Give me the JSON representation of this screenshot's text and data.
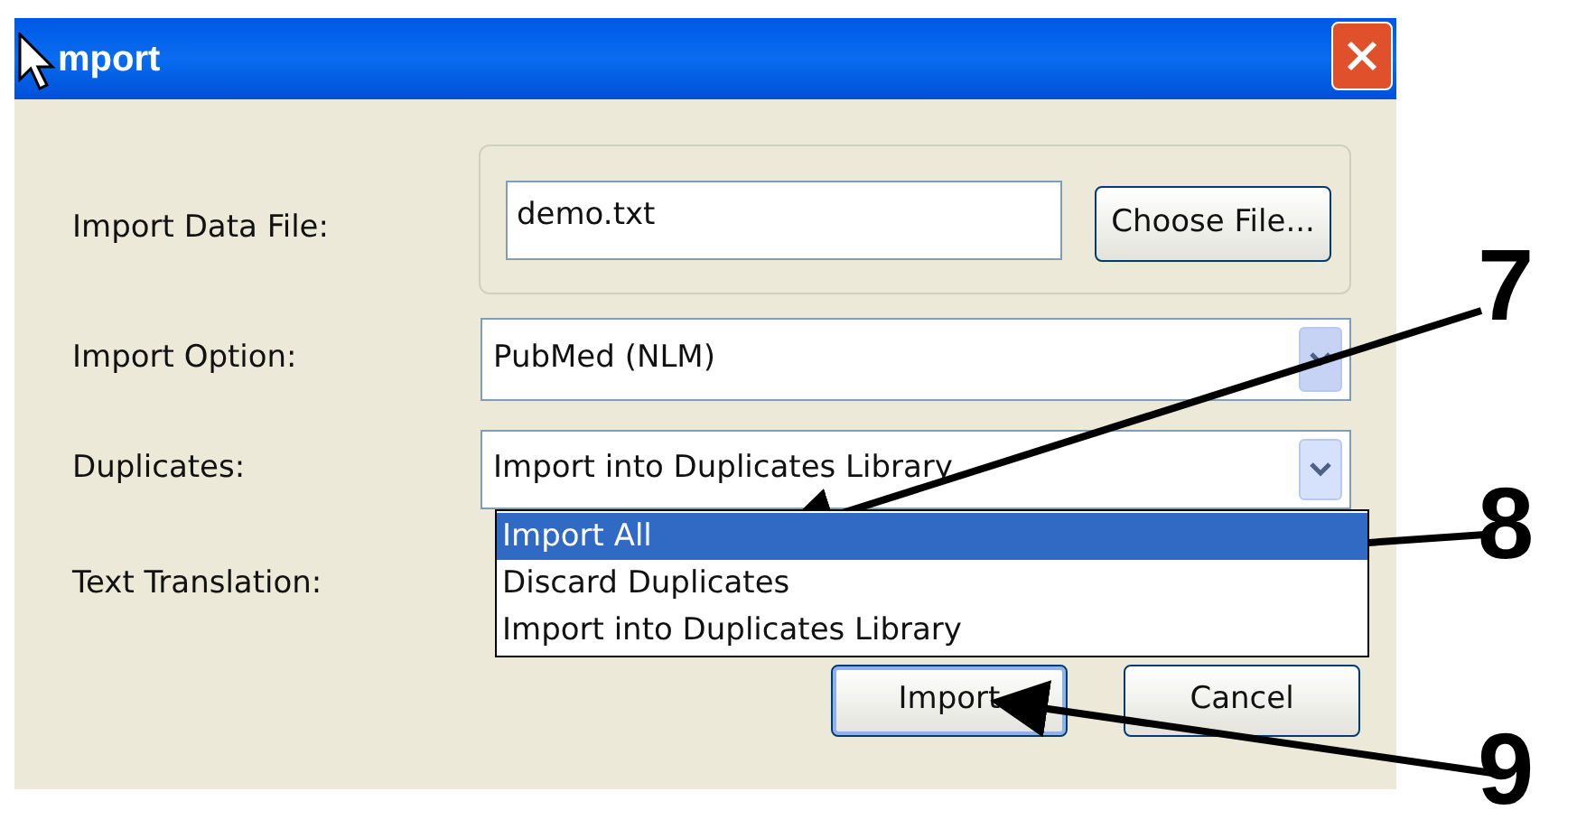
{
  "window": {
    "title": "mport"
  },
  "file_row": {
    "label": "Import Data File:",
    "value": "demo.txt",
    "button": "Choose File..."
  },
  "import_option": {
    "label": "Import Option:",
    "value": "PubMed (NLM)"
  },
  "duplicates": {
    "label": "Duplicates:",
    "value": "Import into Duplicates Library",
    "expanded": true,
    "options": [
      {
        "label": "Import All",
        "highlighted": true
      },
      {
        "label": "Discard Duplicates",
        "highlighted": false
      },
      {
        "label": "Import into Duplicates Library",
        "highlighted": false
      }
    ]
  },
  "text_translation": {
    "label": "Text Translation:"
  },
  "buttons": [
    {
      "label": "Import",
      "default": true
    },
    {
      "label": "Cancel",
      "default": false
    }
  ],
  "callouts": [
    "7",
    "8",
    "9"
  ]
}
